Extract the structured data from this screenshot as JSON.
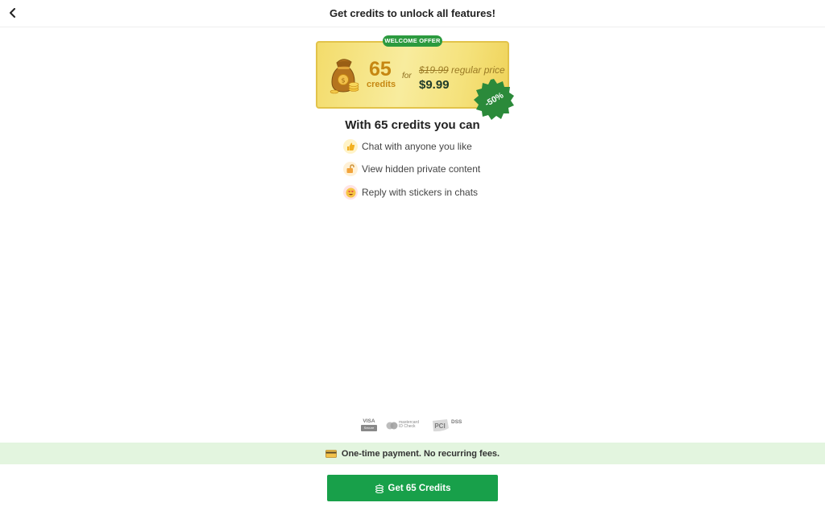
{
  "header": {
    "title": "Get credits to unlock all features!"
  },
  "offer": {
    "badge": "WELCOME OFFER",
    "credits_amount": "65",
    "credits_word": "credits",
    "for_word": "for",
    "old_price": "$19.99",
    "old_price_suffix": " regular price",
    "new_price": "$9.99",
    "discount": "-50%"
  },
  "features": {
    "title": "With 65 credits you can",
    "items": [
      {
        "label": "Chat with anyone you like",
        "icon": "thumbs-up-icon"
      },
      {
        "label": "View hidden private content",
        "icon": "unlock-icon"
      },
      {
        "label": "Reply with stickers in chats",
        "icon": "heart-eyes-icon"
      }
    ]
  },
  "payment_logos": {
    "visa": "VISA",
    "visa_sub": "Secure",
    "mastercard": "mastercard",
    "mastercard_sub": "ID Check",
    "pci": "DSS"
  },
  "notice": {
    "text": "One-time payment. No recurring fees."
  },
  "cta": {
    "label": "Get 65 Credits"
  },
  "colors": {
    "primary_green": "#18a04a",
    "badge_green": "#2c9a3f",
    "gold": "#c68712",
    "notice_bg": "#e3f5df"
  }
}
